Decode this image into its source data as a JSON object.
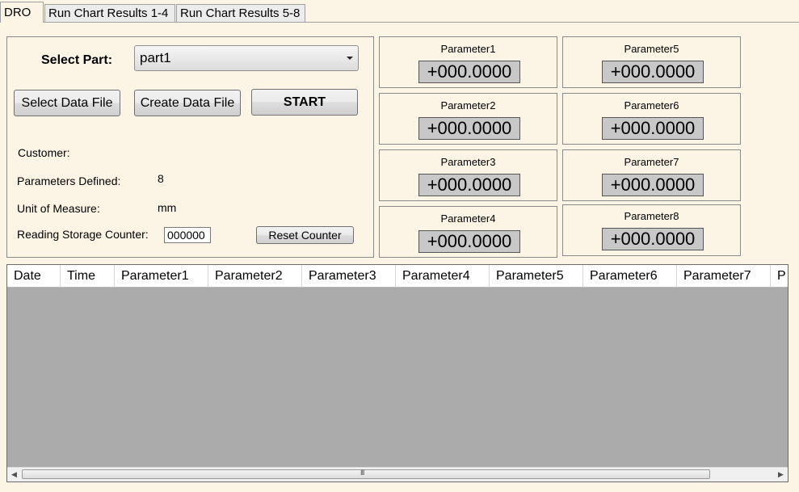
{
  "tabs": [
    {
      "label": "DRO"
    },
    {
      "label": "Run Chart Results 1-4"
    },
    {
      "label": "Run Chart Results 5-8"
    }
  ],
  "setup": {
    "select_part_label": "Select Part:",
    "part_value": "part1",
    "select_data_file_label": "Select Data File",
    "create_data_file_label": "Create Data File",
    "start_label": "START",
    "customer_label": "Customer:",
    "customer_value": "",
    "params_defined_label": "Parameters Defined:",
    "params_defined_value": "8",
    "unit_label": "Unit of Measure:",
    "unit_value": "mm",
    "counter_label": "Reading Storage Counter:",
    "counter_value": "000000",
    "reset_counter_label": "Reset Counter"
  },
  "parameters": [
    {
      "name": "Parameter1",
      "value": "+000.0000"
    },
    {
      "name": "Parameter2",
      "value": "+000.0000"
    },
    {
      "name": "Parameter3",
      "value": "+000.0000"
    },
    {
      "name": "Parameter4",
      "value": "+000.0000"
    },
    {
      "name": "Parameter5",
      "value": "+000.0000"
    },
    {
      "name": "Parameter6",
      "value": "+000.0000"
    },
    {
      "name": "Parameter7",
      "value": "+000.0000"
    },
    {
      "name": "Parameter8",
      "value": "+000.0000"
    }
  ],
  "grid": {
    "columns": [
      "Date",
      "Time",
      "Parameter1",
      "Parameter2",
      "Parameter3",
      "Parameter4",
      "Parameter5",
      "Parameter6",
      "Parameter7",
      "P"
    ],
    "scrollbar": {
      "left_icon": "scroll-left-arrow",
      "right_icon": "scroll-right-arrow",
      "grip": "III"
    }
  },
  "colors": {
    "background": "#fcf5e6",
    "value_box": "#c8c8c8",
    "grid_empty": "#ababab"
  }
}
